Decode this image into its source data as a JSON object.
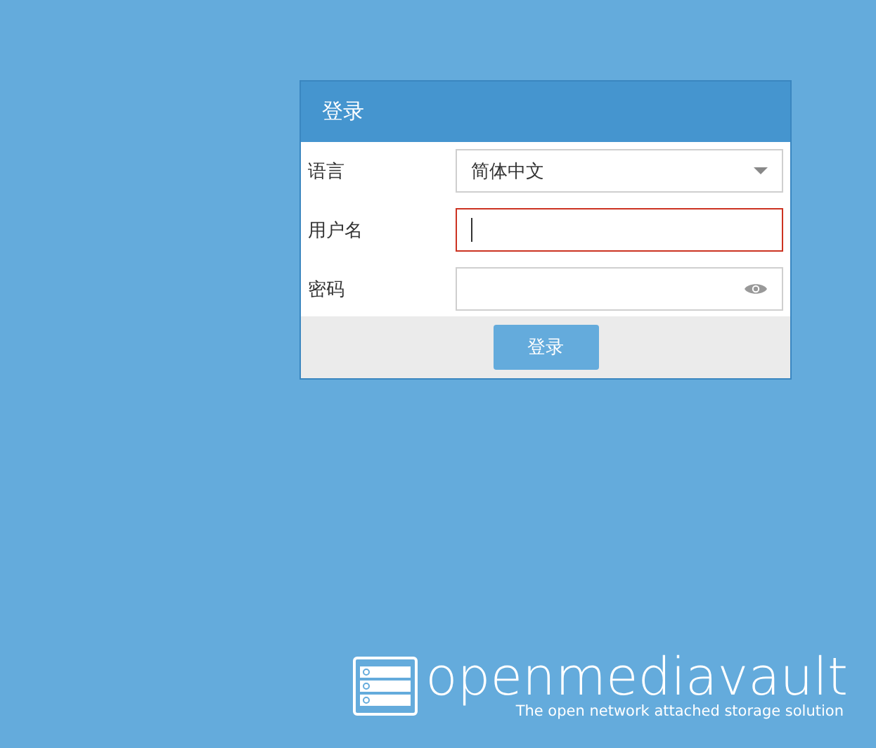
{
  "dialog": {
    "title": "登录",
    "fields": [
      {
        "kind": "select",
        "label": "语言",
        "value": "简体中文",
        "focused": false
      },
      {
        "kind": "text",
        "label": "用户名",
        "focused": true
      },
      {
        "kind": "password",
        "label": "密码",
        "focused": false
      }
    ],
    "button": "登录"
  },
  "brand": {
    "name": "openmediavault",
    "tagline": "The open network attached storage solution"
  }
}
